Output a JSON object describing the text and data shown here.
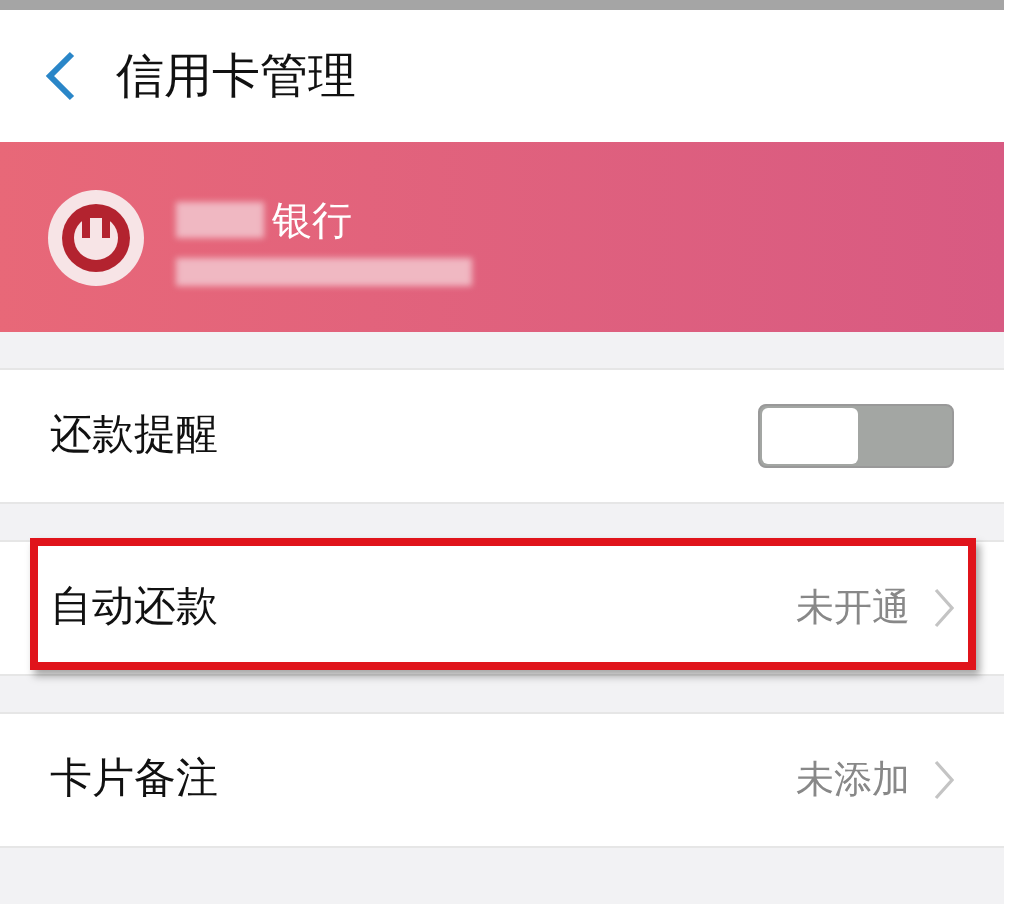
{
  "header": {
    "title": "信用卡管理"
  },
  "card": {
    "bank_name": "银行"
  },
  "rows": [
    {
      "kind": "toggle",
      "label": "还款提醒",
      "on": false,
      "highlighted": false
    },
    {
      "kind": "link",
      "label": "自动还款",
      "value": "未开通",
      "highlighted": true
    },
    {
      "kind": "link",
      "label": "卡片备注",
      "value": "未添加",
      "highlighted": false
    }
  ]
}
